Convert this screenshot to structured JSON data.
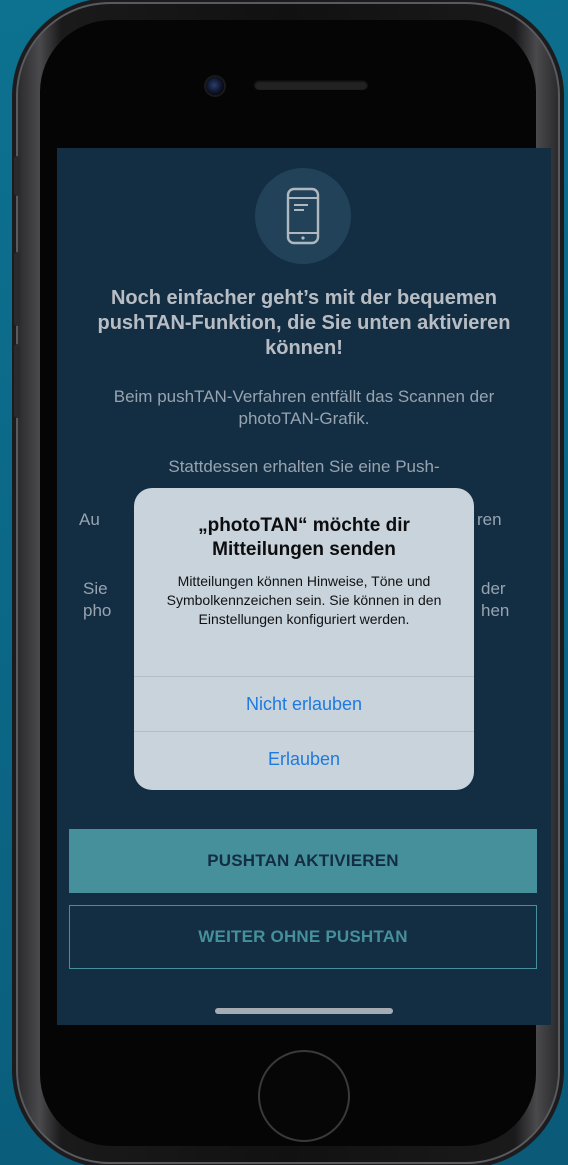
{
  "screen": {
    "headline": "Noch einfacher geht’s mit der bequemen pushTAN-Funktion, die Sie unten aktivieren können!",
    "paragraph1": "Beim pushTAN-Verfahren entfällt das Scannen der photoTAN-Grafik.",
    "paragraph2": "Stattdessen erhalten Sie eine Push-",
    "paragraph3_left": "Au",
    "paragraph3_right": "ren",
    "paragraph4_left_line1": "Sie",
    "paragraph4_left_line2": "pho",
    "paragraph4_right_line1": "der",
    "paragraph4_right_line2": "hen",
    "icon": "smartphone-icon"
  },
  "buttons": {
    "primary": "PUSHTAN AKTIVIEREN",
    "secondary": "WEITER OHNE PUSHTAN"
  },
  "alert": {
    "title": "„photoTAN“ möchte dir Mitteilungen senden",
    "message": "Mitteilungen können Hinweise, Töne und Symbolkennzeichen sein. Sie können in den Einstellungen konfiguriert werden.",
    "deny": "Nicht erlauben",
    "allow": "Erlauben"
  },
  "colors": {
    "background": "#0b6584",
    "screen": "#16344d",
    "accent": "#5ab8c2",
    "ios_blue": "#1e7ae0"
  }
}
